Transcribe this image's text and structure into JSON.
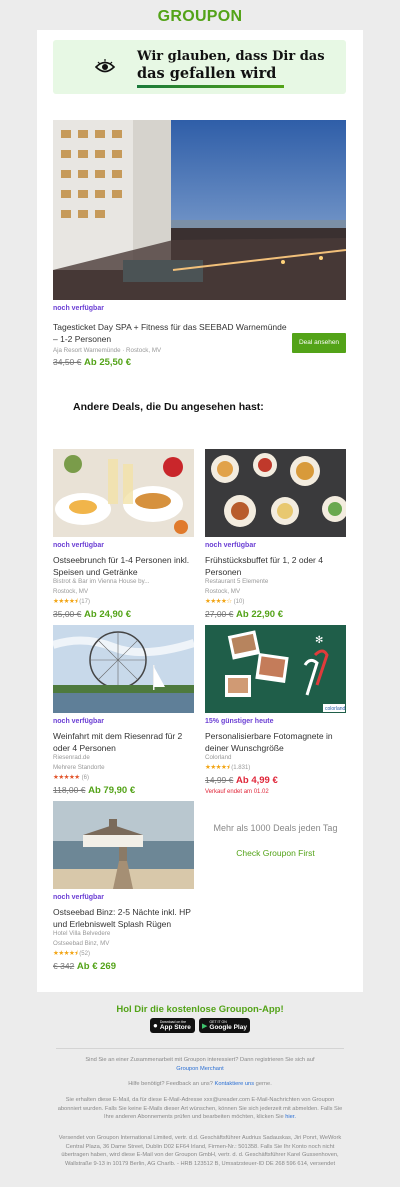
{
  "brand": "GROUPON",
  "banner": {
    "line1": "Wir glauben, dass Dir das",
    "line2": "das gefallen wird"
  },
  "featured": {
    "availability": "noch verfügbar",
    "title": "Tagesticket Day SPA + Fitness für das SEEBAD Warnemünde – 1-2 Personen",
    "merchant": "Aja Resort Warnemünde",
    "location": "Rostock, MV",
    "old_price": "34,50 €",
    "new_price": "Ab 25,50 €",
    "button": "Deal ansehen"
  },
  "section_heading": "Andere Deals, die Du angesehen hast:",
  "deals": [
    {
      "availability": "noch verfügbar",
      "title": "Ostseebrunch für 1-4 Personen inkl. Speisen und Getränke",
      "merchant": "Bistrot & Bar im Vienna House by...",
      "location": "Rostock, MV",
      "stars": "★★★★⯨",
      "reviews": "(17)",
      "old_price": "35,00 €",
      "new_price": "Ab 24,90 €"
    },
    {
      "availability": "noch verfügbar",
      "title": "Frühstücksbuffet für 1, 2 oder 4 Personen",
      "merchant": "Restaurant 5 Elemente",
      "location": "Rostock, MV",
      "stars": "★★★★☆",
      "reviews": "(10)",
      "old_price": "27,00 €",
      "new_price": "Ab 22,90 €"
    },
    {
      "availability": "noch verfügbar",
      "title": "Weinfahrt mit dem Riesenrad für 2 oder 4 Personen",
      "merchant": "Riesenrad.de",
      "location": "Mehrere Standorte",
      "stars": "★★★★★",
      "reviews": "(6)",
      "old_price": "118,00 €",
      "new_price": "Ab 79,90 €"
    },
    {
      "availability": "15% günstiger heute",
      "title": "Personalisierbare Fotomagnete in deiner Wunschgröße",
      "merchant": "Colorland",
      "location": "",
      "stars": "★★★★⯨",
      "reviews": "(1.831)",
      "old_price": "14,99 €",
      "new_price": "Ab 4,99 €",
      "ends": "Verkauf endet am 01.02"
    },
    {
      "availability": "noch verfügbar",
      "title": "Ostseebad Binz: 2-5 Nächte inkl. HP und Erlebniswelt Splash Rügen",
      "merchant": "Hotel Villa Belvedere",
      "location": "Ostseebad Binz, MV",
      "stars": "★★★★⯨",
      "reviews": "(52)",
      "old_price": "€ 342",
      "new_price": "Ab € 269"
    }
  ],
  "more_deals": "Mehr als 1000 Deals jeden Tag",
  "check_link": "Check Groupon First",
  "app": {
    "heading": "Hol Dir die kostenlose Groupon-App!",
    "appstore_small": "Download on the",
    "appstore": "App Store",
    "googleplay_small": "GET IT ON",
    "googleplay": "Google Play"
  },
  "footer": {
    "merchant_q": "Sind Sie an einer Zusammenarbeit mit Groupon interessiert? Dann registrieren Sie sich auf",
    "merchant_link": "Groupon Merchant",
    "help": "Hilfe benötigt? Feedback an uns?",
    "help_link": "Kontaktiere uns",
    "help_end": "gerne.",
    "notice": "Sie erhalten diese E-Mail, da für diese E-Mail-Adresse xxx@ureader.com E-Mail-Nachrichten von Groupon abonniert wurden. Falls Sie keine E-Mails dieser Art wünschen, können Sie sich jederzeit mit abmelden. Falls Sie Ihre anderen Abonnements prüfen und bearbeiten möchten, klicken Sie",
    "notice_link": "hier.",
    "legal": "Versendet von Groupon International Limited, vertr. d.d. Geschäftsführer Audrius Sadauskas, Jiri Ponrt, WeWork Central Plaza, 36 Dame Street, Dublin D02 EF64 Irland, Firmen-Nr.: 501358. Falls Sie Ihr Konto noch nicht übertragen haben, wird diese E-Mail von der Groupon GmbH, vertr. d. d. Geschäftsführer Karel Gussenhoven, Wallstraße 9-13 in 10179 Berlin, AG Charlb. - HRB 123512 B, Umsatzsteuer-ID DE 268 596 614, versendet"
  }
}
